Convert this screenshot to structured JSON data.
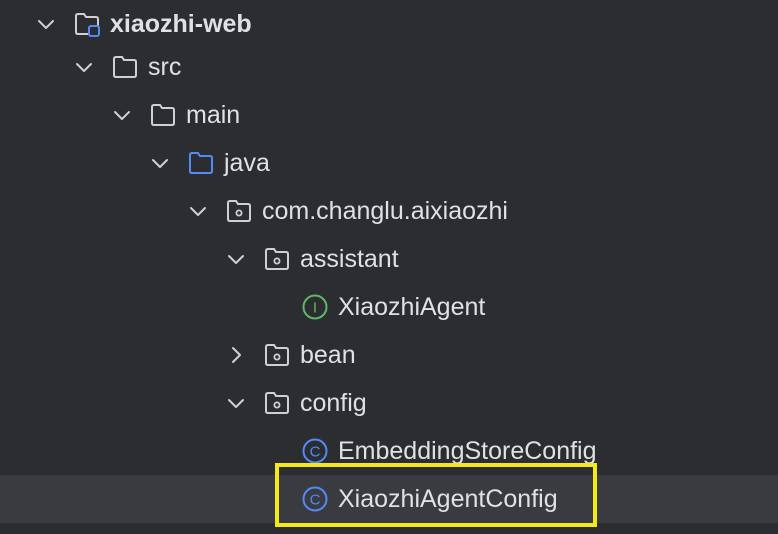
{
  "project_tree": {
    "root": {
      "label": "xiaozhi-web",
      "expanded": true,
      "icon": "module-folder-icon"
    },
    "src": {
      "label": "src",
      "expanded": true,
      "icon": "folder-icon"
    },
    "main": {
      "label": "main",
      "expanded": true,
      "icon": "folder-icon"
    },
    "java": {
      "label": "java",
      "expanded": true,
      "icon": "source-root-folder-icon"
    },
    "package": {
      "label": "com.changlu.aixiaozhi",
      "expanded": true,
      "icon": "package-icon"
    },
    "assistant": {
      "label": "assistant",
      "expanded": true,
      "icon": "package-icon"
    },
    "xiaozhi_agent": {
      "label": "XiaozhiAgent",
      "icon": "interface-icon",
      "badge": "I"
    },
    "bean": {
      "label": "bean",
      "expanded": false,
      "icon": "package-icon"
    },
    "config": {
      "label": "config",
      "expanded": true,
      "icon": "package-icon"
    },
    "embedding_store_config": {
      "label": "EmbeddingStoreConfig",
      "icon": "class-icon",
      "badge": "C"
    },
    "xiaozhi_agent_config": {
      "label": "XiaozhiAgentConfig",
      "icon": "class-icon",
      "badge": "C",
      "selected": true,
      "highlighted": true
    }
  },
  "colors": {
    "background": "#2b2d30",
    "selected_row": "#393b40",
    "text": "#dfe1e5",
    "folder_stroke": "#ced0d6",
    "source_folder": "#548af7",
    "interface": "#5fb865",
    "class": "#548af7",
    "highlight": "#f4ea1a"
  }
}
